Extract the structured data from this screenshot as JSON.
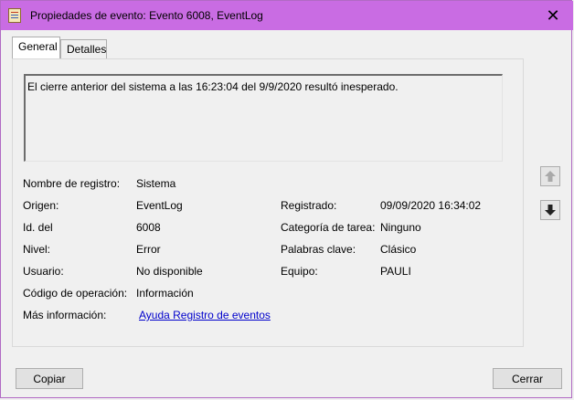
{
  "window": {
    "title": "Propiedades de evento: Evento 6008, EventLog",
    "close_glyph": "✕"
  },
  "tabs": [
    {
      "label": "General"
    },
    {
      "label": "Detalles"
    }
  ],
  "description": "El cierre anterior del sistema a las 16:23:04 del 9/9/2020 resultó inesperado.",
  "fields": {
    "nombre_registro": {
      "label": "Nombre de registro:",
      "value": "Sistema"
    },
    "origen": {
      "label": "Origen:",
      "value": "EventLog"
    },
    "registrado": {
      "label": "Registrado:",
      "value": "09/09/2020 16:34:02"
    },
    "id": {
      "label": "Id. del",
      "value": "6008"
    },
    "categoria": {
      "label": "Categoría de tarea:",
      "value": "Ninguno"
    },
    "nivel": {
      "label": "Nivel:",
      "value": "Error"
    },
    "palabras": {
      "label": "Palabras clave:",
      "value": "Clásico"
    },
    "usuario": {
      "label": "Usuario:",
      "value": "No disponible"
    },
    "equipo": {
      "label": "Equipo:",
      "value": "PAULI"
    },
    "codigo": {
      "label": "Código de operación:",
      "value": "Información"
    },
    "mas_info": {
      "label": "Más información:",
      "link": "Ayuda Registro de eventos"
    }
  },
  "buttons": {
    "copiar": "Copiar",
    "cerrar": "Cerrar"
  },
  "nav": {
    "up_icon": "arrow-up-icon",
    "down_icon": "arrow-down-icon"
  }
}
